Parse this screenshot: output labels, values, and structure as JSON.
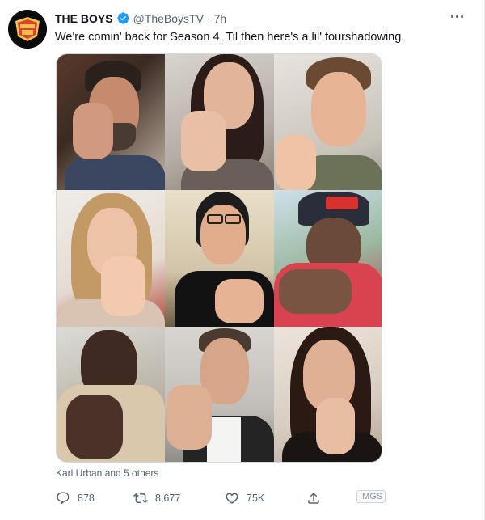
{
  "tweet": {
    "display_name": "THE BOYS",
    "handle": "@TheBoysTV",
    "separator": "·",
    "time": "7h",
    "text": "We're comin' back for Season 4. Til then here's a lil' fourshadowing.",
    "avatar_logo_text": "THE BOYS",
    "tagged_people": "Karl Urban and 5 others",
    "verified_color": "#1d9bf0"
  },
  "media": {
    "tiles": [
      {
        "name": "photo-1"
      },
      {
        "name": "photo-2"
      },
      {
        "name": "photo-3"
      },
      {
        "name": "photo-4"
      },
      {
        "name": "photo-5"
      },
      {
        "name": "photo-6"
      },
      {
        "name": "photo-7"
      },
      {
        "name": "photo-8"
      },
      {
        "name": "photo-9"
      }
    ]
  },
  "actions": {
    "reply_count": "878",
    "retweet_count": "8,677",
    "like_count": "75K",
    "watermark": "IMGS"
  },
  "icons": {
    "reply": "reply-icon",
    "retweet": "retweet-icon",
    "like": "heart-icon",
    "share": "share-icon",
    "more": "more-icon",
    "verified": "verified-badge-icon"
  },
  "colors": {
    "text_primary": "#0f1419",
    "text_secondary": "#536471",
    "accent": "#1d9bf0"
  }
}
